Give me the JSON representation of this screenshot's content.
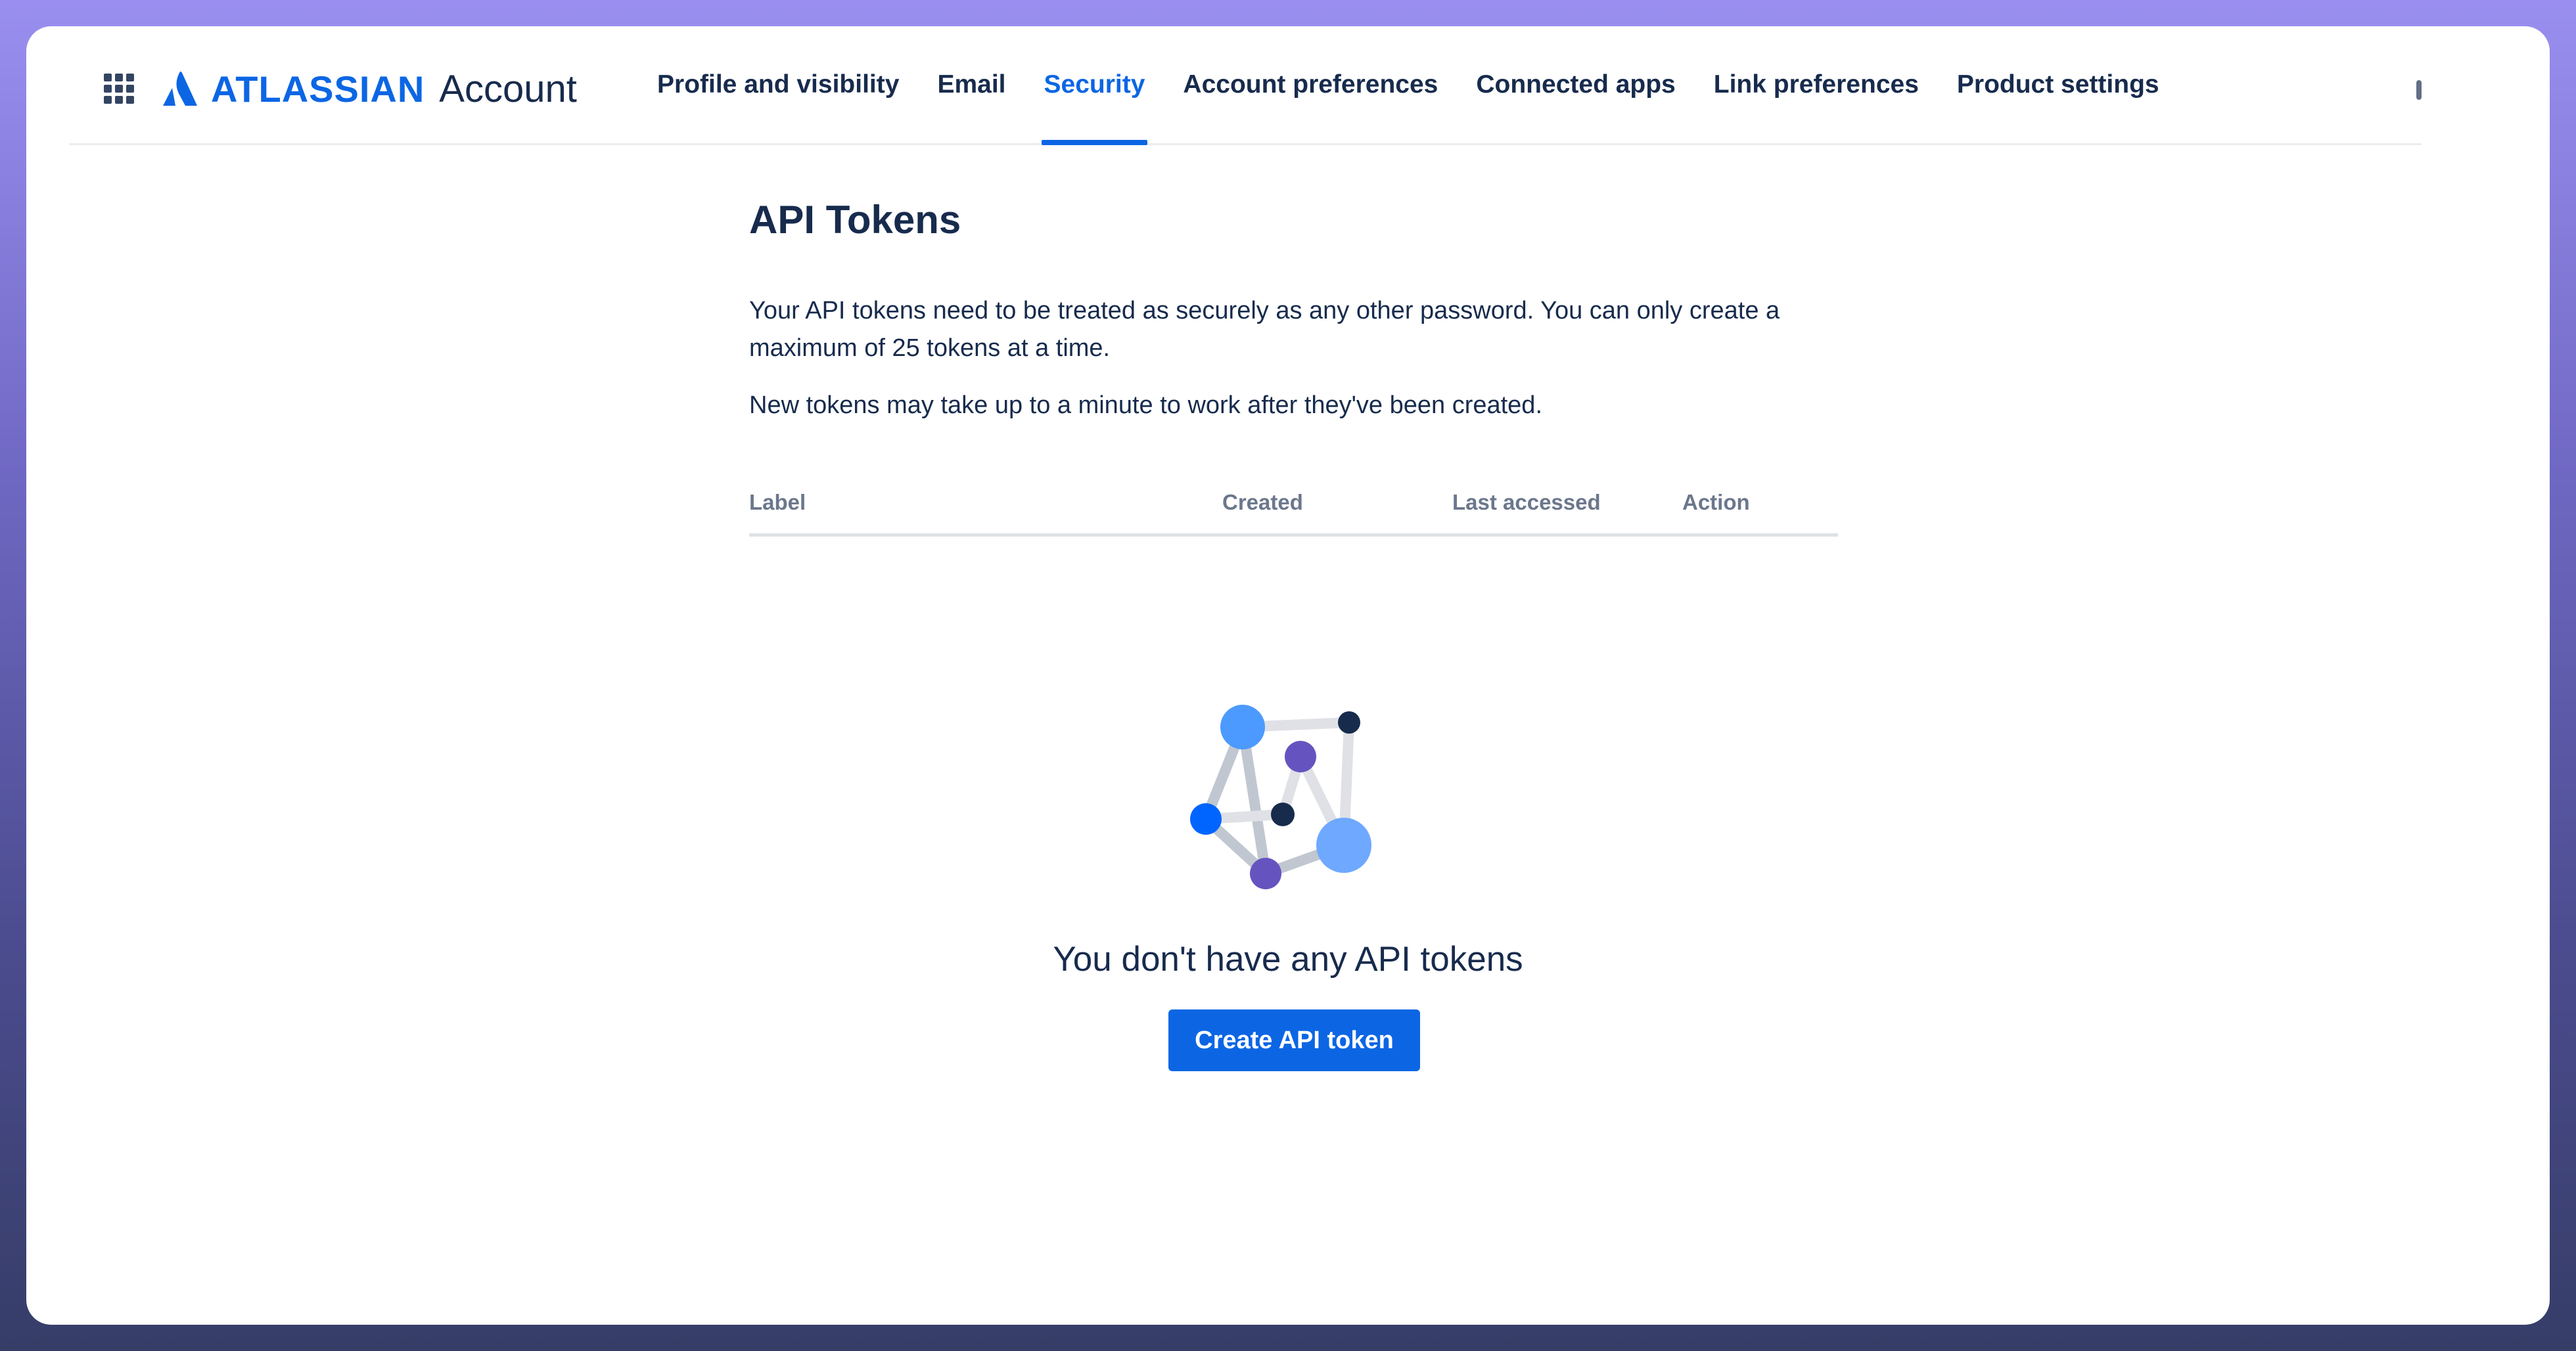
{
  "header": {
    "app_switcher_icon": "grid-icon",
    "brand": "ATLASSIAN",
    "product": "Account",
    "nav": [
      {
        "label": "Profile and visibility",
        "active": false
      },
      {
        "label": "Email",
        "active": false
      },
      {
        "label": "Security",
        "active": true
      },
      {
        "label": "Account preferences",
        "active": false
      },
      {
        "label": "Connected apps",
        "active": false
      },
      {
        "label": "Link preferences",
        "active": false
      },
      {
        "label": "Product settings",
        "active": false
      }
    ]
  },
  "main": {
    "title": "API Tokens",
    "description_1": "Your API tokens need to be treated as securely as any other password. You can only create a maximum of 25 tokens at a time.",
    "description_2": "New tokens may take up to a minute to work after they've been created.",
    "table": {
      "columns": [
        "Label",
        "Created",
        "Last accessed",
        "Action"
      ],
      "rows": []
    },
    "empty_state": {
      "illustration_icon": "network-nodes-icon",
      "title": "You don't have any API tokens",
      "button_label": "Create API token"
    }
  },
  "colors": {
    "accent": "#0c66e4",
    "text": "#172b4d",
    "muted": "#6b778c",
    "divider": "#dfe1e6"
  }
}
